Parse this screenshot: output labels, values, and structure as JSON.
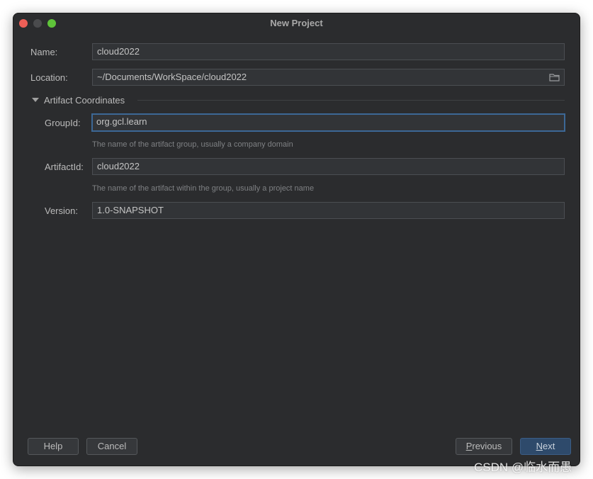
{
  "window": {
    "title": "New Project"
  },
  "form": {
    "name": {
      "label": "Name:",
      "value": "cloud2022"
    },
    "location": {
      "label": "Location:",
      "value": "~/Documents/WorkSpace/cloud2022",
      "icon": "folder-icon"
    },
    "section": {
      "label": "Artifact Coordinates",
      "expanded": true
    },
    "group_id": {
      "label": "GroupId:",
      "value": "org.gcl.learn",
      "hint": "The name of the artifact group, usually a company domain"
    },
    "artifact_id": {
      "label": "ArtifactId:",
      "value": "cloud2022",
      "hint": "The name of the artifact within the group, usually a project name"
    },
    "version": {
      "label": "Version:",
      "value": "1.0-SNAPSHOT"
    }
  },
  "buttons": {
    "help": "Help",
    "cancel": "Cancel",
    "previous_mnemonic": "P",
    "previous_rest": "revious",
    "next_mnemonic": "N",
    "next_rest": "ext"
  },
  "watermark": "CSDN @临水而愚",
  "colors": {
    "accent": "#3c6896",
    "primary_button": "#2e4a6b"
  }
}
